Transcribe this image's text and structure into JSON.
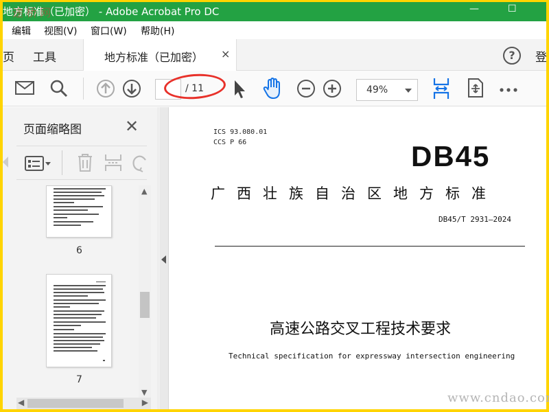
{
  "window": {
    "title": "地方标准（已加密） - Adobe Acrobat Pro DC",
    "watermark_top": "途桥网",
    "minimize": "—",
    "maximize": "☐"
  },
  "menu": [
    "编辑",
    "视图(V)",
    "窗口(W)",
    "帮助(H)"
  ],
  "tabs": {
    "partial_left": "页",
    "tools": "工具",
    "document": "地方标准（已加密）",
    "close": "×",
    "help": "?",
    "signin_partial": "登"
  },
  "toolbar": {
    "page_current": "",
    "page_total": "/ 11",
    "zoom": "49%"
  },
  "sidebar": {
    "title": "页面缩略图",
    "close": "✕",
    "thumbnails": [
      {
        "label": "6"
      },
      {
        "label": "7"
      }
    ]
  },
  "document": {
    "ics": "ICS  93.080.01",
    "ccs": "CCS  P  66",
    "code": "DB45",
    "standard_name": "广西壮族自治区地方标准",
    "standard_number": "DB45/T  2931—2024",
    "title_cn": "高速公路交叉工程技术要求",
    "title_en": "Technical specification for expressway intersection engineering"
  },
  "watermark_bottom": "www.cndao.com",
  "colors": {
    "title_bar": "#23a243",
    "frame": "#ffd400",
    "accent_blue": "#1473e6",
    "annotation_red": "#e8312a"
  }
}
